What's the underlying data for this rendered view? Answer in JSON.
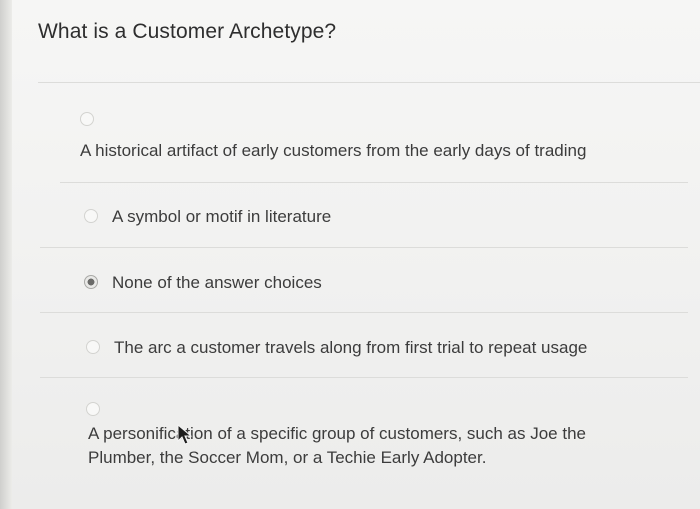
{
  "question": {
    "title": "What is a Customer Archetype?"
  },
  "options": [
    {
      "label": "A historical artifact of early customers from the early days of trading",
      "selected": false
    },
    {
      "label": "A symbol or motif in literature",
      "selected": false
    },
    {
      "label": "None of the answer choices",
      "selected": true
    },
    {
      "label": "The arc a customer travels along from first trial to repeat usage",
      "selected": false
    },
    {
      "label": "A personification of a specific group of customers, such as Joe the Plumber, the Soccer Mom, or a Techie Early Adopter.",
      "selected": false
    }
  ],
  "cursor": {
    "icon": "mouse-pointer-icon"
  }
}
